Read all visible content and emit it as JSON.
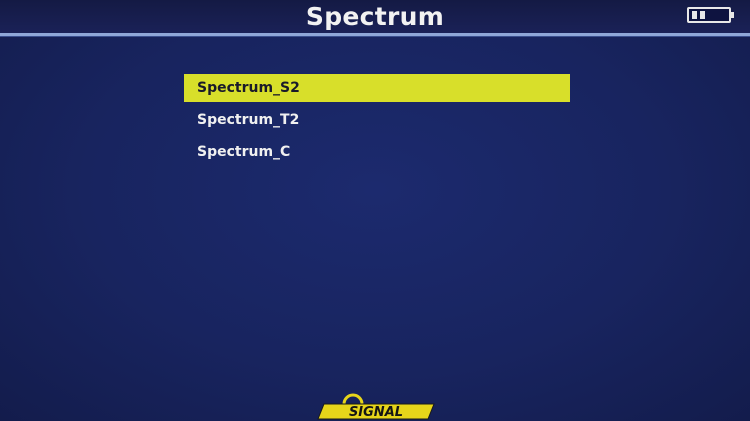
{
  "header": {
    "title": "Spectrum",
    "battery_icon": "battery-icon",
    "battery_level": 0.4
  },
  "menu": {
    "items": [
      {
        "label": "Spectrum_S2",
        "selected": true
      },
      {
        "label": "Spectrum_T2",
        "selected": false
      },
      {
        "label": "Spectrum_C",
        "selected": false
      }
    ]
  },
  "logo": {
    "text": "SIGNAL"
  },
  "colors": {
    "background": "#18245f",
    "header_border": "#8fa7d8",
    "selection": "#d8df2a",
    "logo_yellow": "#e7d51a",
    "text": "#f0f0f0"
  }
}
